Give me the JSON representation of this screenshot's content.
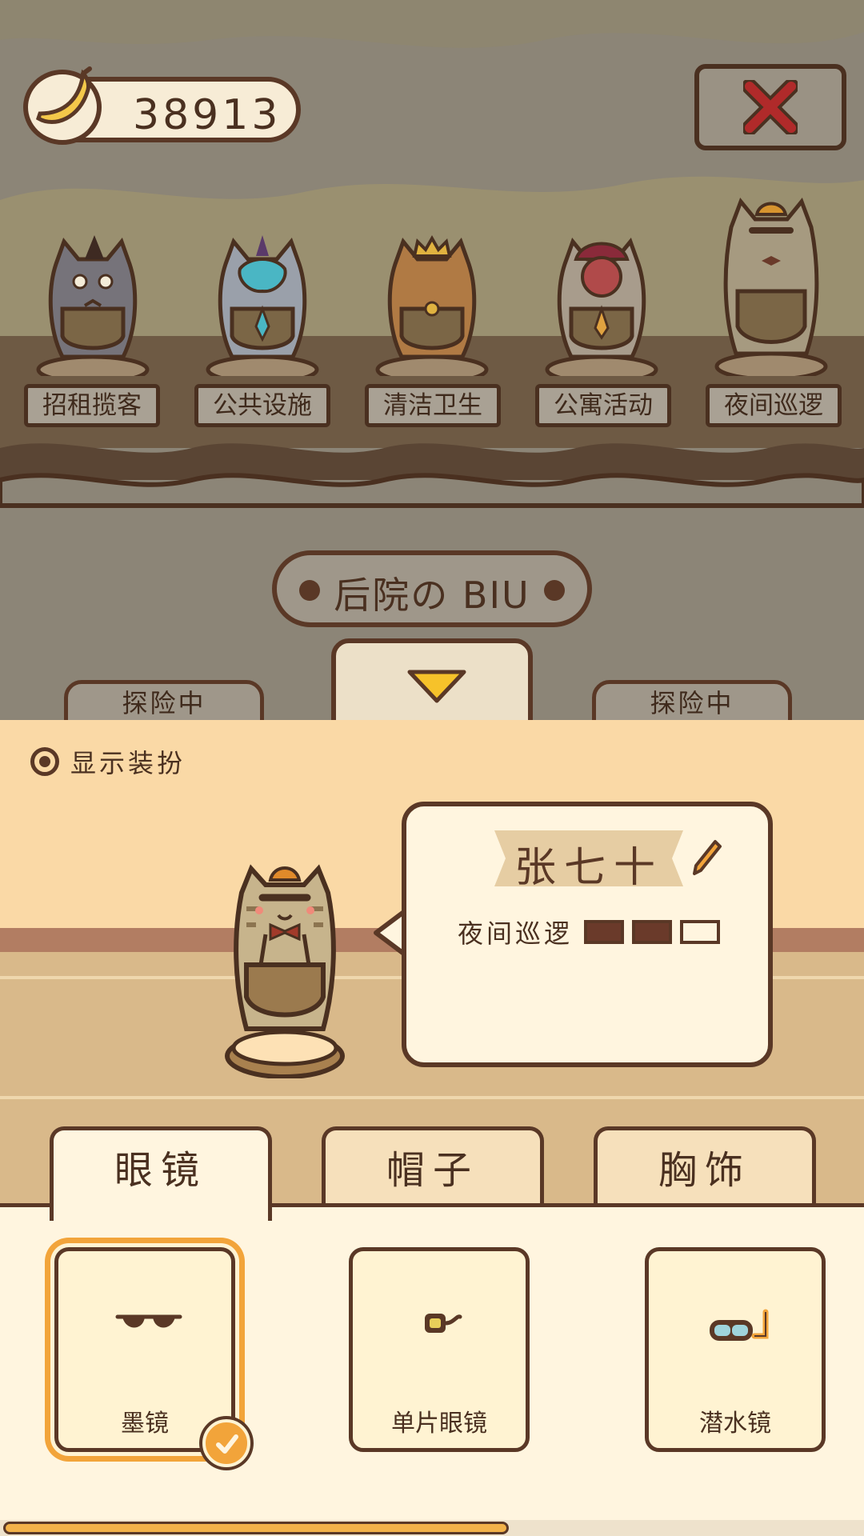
{
  "currency": {
    "icon": "banana-icon",
    "value": "38913"
  },
  "close_button": {
    "icon": "close-icon",
    "color": "#b02a2a"
  },
  "stations": [
    {
      "label": "招租揽客"
    },
    {
      "label": "公共设施"
    },
    {
      "label": "清洁卫生"
    },
    {
      "label": "公寓活动"
    },
    {
      "label": "夜间巡逻"
    }
  ],
  "yard_title": "后院の BIU",
  "status_tags": {
    "left": "探险中",
    "right": "探险中"
  },
  "panel": {
    "show_outfit_label": "显示装扮",
    "character": {
      "name": "张七十",
      "role": "夜间巡逻",
      "level_filled": 2,
      "level_max": 3
    },
    "tabs": [
      {
        "label": "眼镜",
        "active": true
      },
      {
        "label": "帽子",
        "active": false
      },
      {
        "label": "胸饰",
        "active": false
      }
    ],
    "items": [
      {
        "label": "墨镜",
        "icon": "sunglasses-icon",
        "selected": true
      },
      {
        "label": "单片眼镜",
        "icon": "monocle-icon",
        "selected": false
      },
      {
        "label": "潜水镜",
        "icon": "diving-mask-icon",
        "selected": false
      }
    ],
    "scroll_progress": 0.59
  },
  "colors": {
    "accent": "#f2a43a",
    "outline": "#5a3826",
    "panel": "#fad9a6",
    "selected_ring": "#f2a43a"
  }
}
